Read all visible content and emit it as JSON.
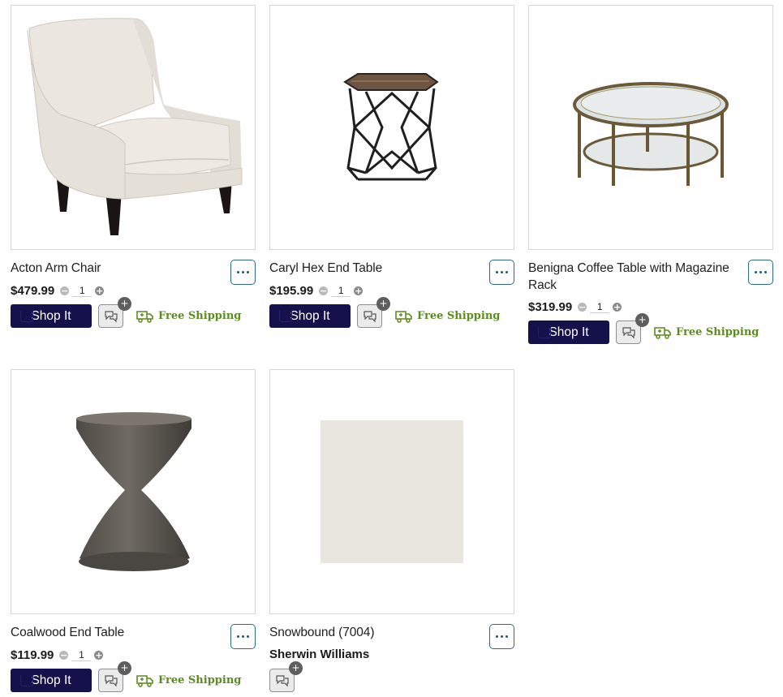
{
  "products": [
    {
      "name": "Acton Arm Chair",
      "price": "$479.99",
      "qty": "1",
      "shop_label": "Shop It",
      "shipping": "Free Shipping",
      "image_icon": "arm-chair",
      "more_icon": "ellipsis-icon"
    },
    {
      "name": "Caryl Hex End Table",
      "price": "$195.99",
      "qty": "1",
      "shop_label": "Shop It",
      "shipping": "Free Shipping",
      "image_icon": "hex-end-table",
      "more_icon": "ellipsis-icon"
    },
    {
      "name": "Benigna Coffee Table with Magazine Rack",
      "price": "$319.99",
      "qty": "1",
      "shop_label": "Shop It",
      "shipping": "Free Shipping",
      "image_icon": "glass-coffee-table",
      "more_icon": "ellipsis-icon"
    },
    {
      "name": "Coalwood End Table",
      "price": "$119.99",
      "qty": "1",
      "shop_label": "Shop It",
      "shipping": "Free Shipping",
      "image_icon": "concrete-end-table",
      "more_icon": "ellipsis-icon"
    },
    {
      "name": "Snowbound (7004)",
      "brand": "Sherwin Williams",
      "swatch_color": "#e9e6e0",
      "image_icon": "paint-swatch",
      "more_icon": "ellipsis-icon"
    }
  ],
  "qty_controls": {
    "minus": "−",
    "plus": "+"
  },
  "chat_plus": "+",
  "colors": {
    "shop_button": "#15114a",
    "free_shipping": "#5c8b21",
    "more_border": "#2a6b82",
    "swatch": "#e9e6e0"
  }
}
